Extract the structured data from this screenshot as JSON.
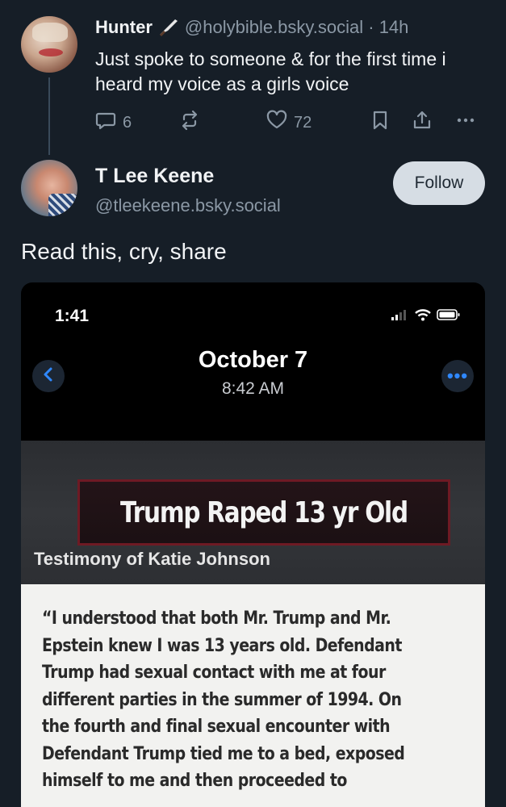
{
  "parent_post": {
    "display_name": "Hunter",
    "handle_time": "@holybible.bsky.social · 14h",
    "text": "Just spoke to someone & for the first time i heard my voice as a girls voice",
    "actions": {
      "reply_count": "6",
      "repost_count": "",
      "like_count": "72"
    }
  },
  "main_post": {
    "display_name": "T Lee Keene",
    "handle": "@tleekeene.bsky.social",
    "follow_label": "Follow",
    "text": "Read this, cry, share"
  },
  "embed": {
    "phone_time": "1:41",
    "date": "October 7",
    "time": "8:42 AM",
    "more_label": "•••",
    "headline": "Trump Raped 13 yr Old",
    "subhead": "Testimony of Katie Johnson",
    "quote_lines": [
      "“I understood that both Mr. Trump and Mr.",
      "Epstein knew I was 13 years old. Defendant",
      "Trump had sexual contact with me at four",
      "different parties in the summer of 1994. On",
      "the fourth and final sexual encounter with",
      "Defendant Trump tied me to a bed, exposed",
      "himself to me and then proceeded to"
    ]
  },
  "icons": {
    "reply": "speech-bubble-icon",
    "repost": "repost-arrows-icon",
    "like": "heart-icon",
    "bookmark": "bookmark-icon",
    "share": "share-icon",
    "more": "ellipsis-icon",
    "knife": "knife-icon"
  },
  "colors": {
    "background": "#161e27",
    "muted_text": "#8b98a5",
    "follow_button": "#d6dde4",
    "ios_blue": "#2f88ff"
  }
}
